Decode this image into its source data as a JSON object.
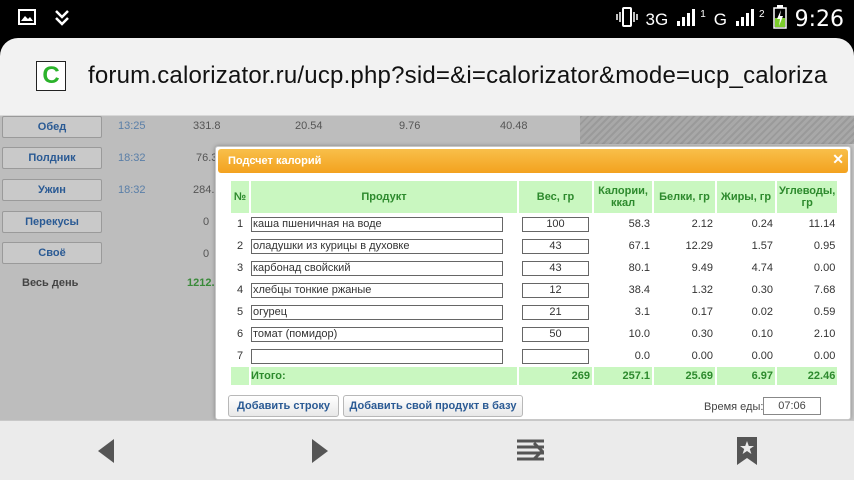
{
  "status_bar": {
    "network_3g": "3G",
    "network_g": "G",
    "sim1": "1",
    "sim2": "2",
    "time": "9:26"
  },
  "browser": {
    "favicon_letter": "C",
    "url": "forum.calorizator.ru/ucp.php?sid=&i=calorizator&mode=ucp_caloriza"
  },
  "background_page": {
    "meals": [
      {
        "label": "Обед",
        "time": "13:25",
        "kcal": "331.8",
        "protein": "20.54",
        "fat": "9.76",
        "carbs": "40.48"
      },
      {
        "label": "Полдник",
        "time": "18:32",
        "kcal": "76.3"
      },
      {
        "label": "Ужин",
        "time": "18:32",
        "kcal": "284."
      },
      {
        "label": "Перекусы",
        "kcal": "0"
      },
      {
        "label": "Своё",
        "kcal": "0"
      }
    ],
    "day_label": "Весь день",
    "day_total": "1212."
  },
  "dialog": {
    "title": "Подсчет калорий",
    "columns": [
      "№",
      "Продукт",
      "Вес, гр",
      "Калории, ккал",
      "Белки, гр",
      "Жиры, гр",
      "Углеводы, гр"
    ],
    "rows": [
      {
        "n": "1",
        "product": "каша пшеничная на воде",
        "weight": "100",
        "kcal": "58.3",
        "protein": "2.12",
        "fat": "0.24",
        "carbs": "11.14"
      },
      {
        "n": "2",
        "product": "оладушки из курицы в духовке",
        "weight": "43",
        "kcal": "67.1",
        "protein": "12.29",
        "fat": "1.57",
        "carbs": "0.95"
      },
      {
        "n": "3",
        "product": "карбонад свойский",
        "weight": "43",
        "kcal": "80.1",
        "protein": "9.49",
        "fat": "4.74",
        "carbs": "0.00"
      },
      {
        "n": "4",
        "product": "хлебцы тонкие ржаные",
        "weight": "12",
        "kcal": "38.4",
        "protein": "1.32",
        "fat": "0.30",
        "carbs": "7.68"
      },
      {
        "n": "5",
        "product": "огурец",
        "weight": "21",
        "kcal": "3.1",
        "protein": "0.17",
        "fat": "0.02",
        "carbs": "0.59"
      },
      {
        "n": "6",
        "product": "томат (помидор)",
        "weight": "50",
        "kcal": "10.0",
        "protein": "0.30",
        "fat": "0.10",
        "carbs": "2.10"
      },
      {
        "n": "7",
        "product": "",
        "weight": "",
        "kcal": "0.0",
        "protein": "0.00",
        "fat": "0.00",
        "carbs": "0.00"
      }
    ],
    "total": {
      "label": "Итого:",
      "weight": "269",
      "kcal": "257.1",
      "protein": "25.69",
      "fat": "6.97",
      "carbs": "22.46"
    },
    "add_row_label": "Добавить строку",
    "add_product_label": "Добавить свой продукт в базу",
    "meal_time_label": "Время еды:",
    "meal_time_value": "07:06"
  },
  "colors": {
    "accent_orange": "#f3a21f",
    "header_green_bg": "#c9f7c0",
    "header_green_text": "#2d8a2d",
    "link_blue": "#2a5a94"
  },
  "icons": [
    "image-icon",
    "download-icon",
    "vibrate-icon",
    "signal-icon",
    "battery-charging-icon",
    "back-icon",
    "forward-icon",
    "tabs-icon",
    "bookmark-icon"
  ]
}
